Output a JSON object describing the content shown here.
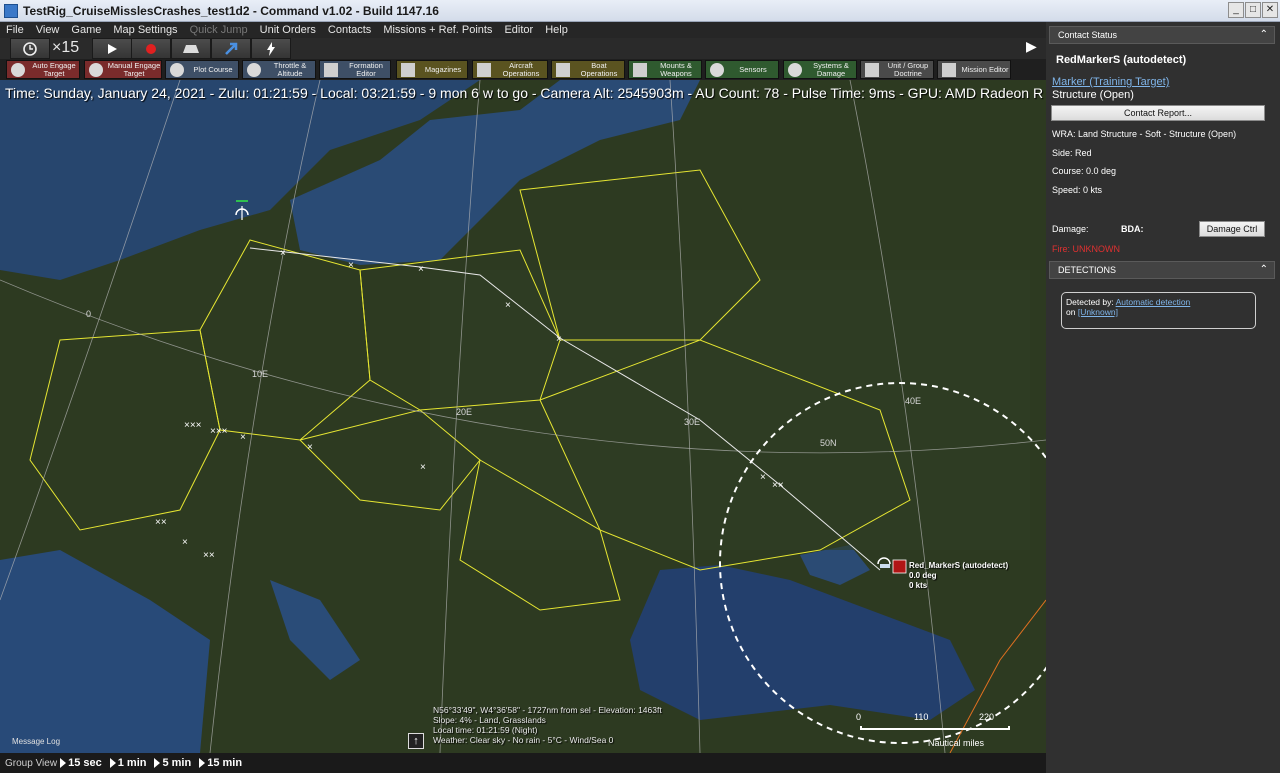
{
  "window": {
    "title": "TestRig_CruiseMisslesCrashes_test1d2 - Command v1.02 - Build 1147.16",
    "controls": [
      "_",
      "□",
      "✕"
    ]
  },
  "menu": [
    "File",
    "View",
    "Game",
    "Map Settings",
    "Quick Jump",
    "Unit Orders",
    "Contacts",
    "Missions + Ref. Points",
    "Editor",
    "Help"
  ],
  "toolbar": {
    "speed": "×15",
    "buttons": [
      "clock-icon",
      "play-icon",
      "record-icon",
      "vehicle-icon",
      "arrow-icon",
      "lightning-icon"
    ]
  },
  "toolbar2": [
    {
      "label": "Auto Engage Target",
      "color": "#7a2b2b"
    },
    {
      "label": "Manual Engage Target",
      "color": "#7a2b2b"
    },
    {
      "label": "Plot Course",
      "color": "#3e4f66"
    },
    {
      "label": "Throttle & Altitude",
      "color": "#3e4f66"
    },
    {
      "label": "Formation Editor",
      "color": "#3e4f66"
    },
    {
      "label": "Magazines",
      "color": "#5a5320"
    },
    {
      "label": "Aircraft Operations",
      "color": "#5a5320"
    },
    {
      "label": "Boat Operations",
      "color": "#5a5320"
    },
    {
      "label": "Mounts & Weapons",
      "color": "#2f5a2f"
    },
    {
      "label": "Sensors",
      "color": "#2f5a2f"
    },
    {
      "label": "Systems & Damage",
      "color": "#2f5a2f"
    },
    {
      "label": "Unit / Group Doctrine",
      "color": "#4a4a4a"
    },
    {
      "label": "Mission Editor",
      "color": "#4a4a4a"
    }
  ],
  "map": {
    "infoline": "Time: Sunday, January 24, 2021 - Zulu: 01:21:59 - Local: 03:21:59 - 9 mon 6 w to go - Camera Alt: 2545903m - AU Count: 78 - Pulse Time: 9ms - GPU: AMD Radeon R",
    "grid_labels": [
      "0",
      "10E",
      "20E",
      "30E",
      "40E",
      "50N"
    ],
    "unit": {
      "name": "Red_MarkerS (autodetect)",
      "course": "0.0 deg",
      "speed": "0 kts"
    },
    "cursor_info": [
      "N56°33'49\", W4°36'58\" - 1727nm from sel - Elevation: 1463ft",
      "Slope: 4% - Land, Grasslands",
      "Local time: 01:21:59 (Night)",
      "Weather: Clear sky - No rain - 5°C - Wind/Sea 0"
    ],
    "message_log": "Message Log",
    "scale": {
      "ticks": [
        "0",
        "110",
        "220"
      ],
      "unit": "Nautical miles"
    }
  },
  "statusbar": {
    "group_view": "Group View",
    "time_jumps": [
      "15 sec",
      "1 min",
      "5 min",
      "15 min"
    ]
  },
  "panel": {
    "header": "Contact Status",
    "contact_name": "RedMarkerS (autodetect)",
    "type_link": "Marker (Training Target)",
    "type_sub": "Structure (Open)",
    "report_button": "Contact Report...",
    "wra": "WRA: Land Structure - Soft - Structure (Open)",
    "side": "Side: Red",
    "course": "Course: 0.0 deg",
    "speed": "Speed: 0 kts",
    "damage_label": "Damage:",
    "bda_label": "BDA:",
    "damage_ctrl_button": "Damage Ctrl",
    "fire": "Fire: UNKNOWN",
    "detections_header": "DETECTIONS",
    "detected_by_prefix": "Detected by: ",
    "detected_by_link": "Automatic detection",
    "on_prefix": "on ",
    "on_link": "[Unknown]"
  }
}
